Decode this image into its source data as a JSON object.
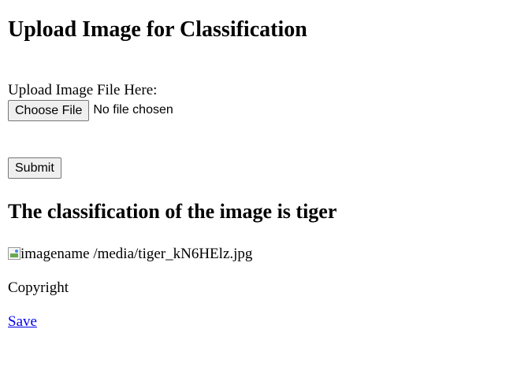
{
  "page": {
    "heading": "Upload Image for Classification",
    "upload_label": "Upload Image File Here:",
    "file_input": {
      "button_label": "Choose File",
      "status_text": "No file chosen"
    },
    "submit_label": "Submit",
    "result_heading": "The classification of the image is tiger",
    "image": {
      "alt_text": "imagename /media/tiger_kN6HElz.jpg",
      "icon": "broken-image-icon"
    },
    "copyright": "Copyright",
    "save_link": "Save"
  },
  "colors": {
    "link": "#0000ee",
    "button_bg": "#efefef",
    "button_border": "#767676"
  }
}
